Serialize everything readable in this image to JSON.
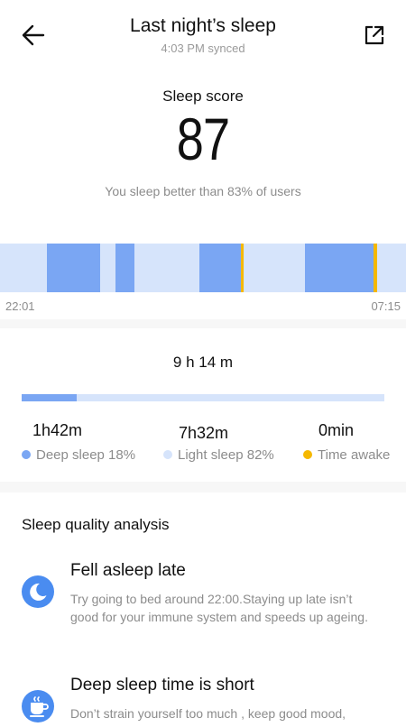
{
  "header": {
    "title": "Last night’s sleep",
    "subtitle": "4:03 PM synced",
    "back_icon": "arrow-left-icon",
    "share_icon": "share-external-icon"
  },
  "score": {
    "label": "Sleep score",
    "value": "87",
    "comparison": "You sleep better than 83% of users"
  },
  "timeline": {
    "start": "22:01",
    "end": "07:15",
    "colors": {
      "light": "#d6e4fb",
      "deep": "#7aa6f3",
      "awake": "#f5b800"
    }
  },
  "summary": {
    "total_duration": "9 h 14 m",
    "deep_fraction": 0.18,
    "stats": [
      {
        "value": "1h42m",
        "label": "Deep sleep 18%",
        "color": "#7aa6f3"
      },
      {
        "value": "7h32m",
        "label": "Light sleep 82%",
        "color": "#d6e4fb"
      },
      {
        "value": "0min",
        "label": "Time awake",
        "color": "#f5b800"
      }
    ]
  },
  "analysis": {
    "title": "Sleep quality analysis",
    "items": [
      {
        "icon": "moon-icon",
        "title": "Fell asleep late",
        "description": "Try going to bed around 22:00.Staying up late isn’t good for your immune system and speeds up ageing."
      },
      {
        "icon": "coffee-cup-icon",
        "title": "Deep sleep time is short",
        "description": "Don’t strain yourself too much , keep good mood,"
      }
    ]
  }
}
